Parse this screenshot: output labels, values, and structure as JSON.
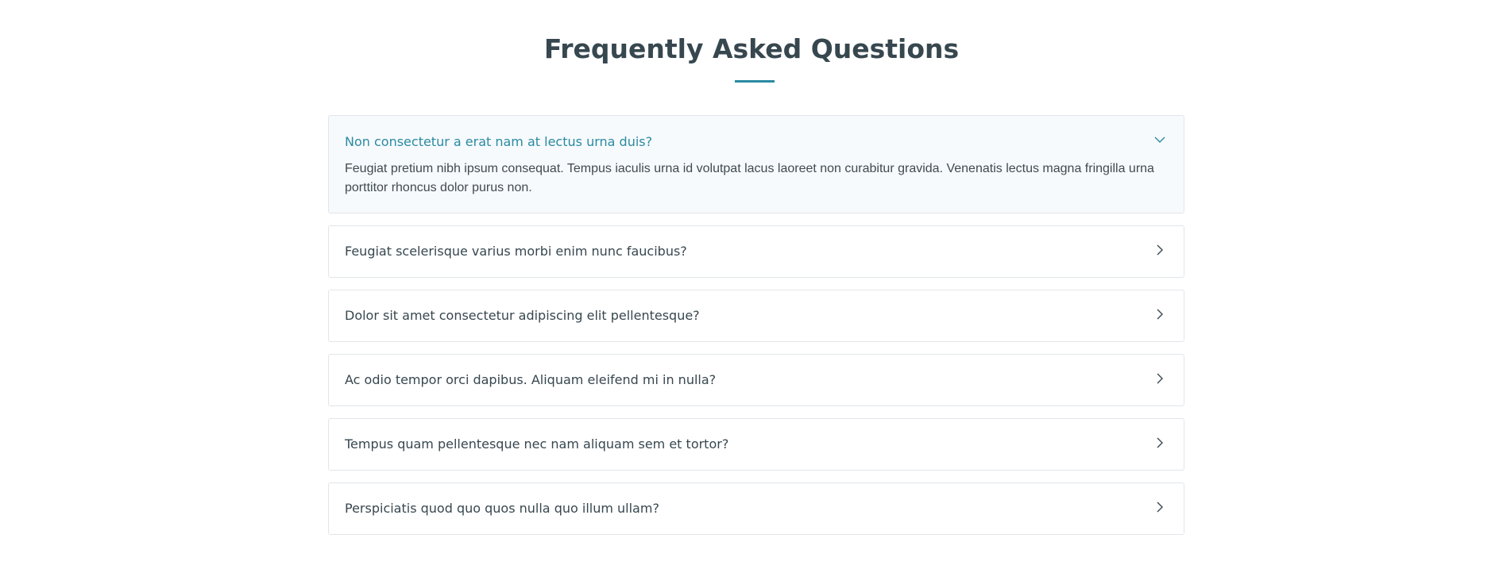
{
  "faq": {
    "title": "Frequently Asked Questions",
    "accent_color": "#2a8aa2",
    "items": [
      {
        "question": "Non consectetur a erat nam at lectus urna duis?",
        "answer": "Feugiat pretium nibh ipsum consequat. Tempus iaculis urna id volutpat lacus laoreet non curabitur gravida. Venenatis lectus magna fringilla urna porttitor rhoncus dolor purus non.",
        "expanded": true,
        "icon": "chevron-down-icon"
      },
      {
        "question": "Feugiat scelerisque varius morbi enim nunc faucibus?",
        "expanded": false,
        "icon": "chevron-right-icon"
      },
      {
        "question": "Dolor sit amet consectetur adipiscing elit pellentesque?",
        "expanded": false,
        "icon": "chevron-right-icon"
      },
      {
        "question": "Ac odio tempor orci dapibus. Aliquam eleifend mi in nulla?",
        "expanded": false,
        "icon": "chevron-right-icon"
      },
      {
        "question": "Tempus quam pellentesque nec nam aliquam sem et tortor?",
        "expanded": false,
        "icon": "chevron-right-icon"
      },
      {
        "question": "Perspiciatis quod quo quos nulla quo illum ullam?",
        "expanded": false,
        "icon": "chevron-right-icon"
      }
    ]
  }
}
